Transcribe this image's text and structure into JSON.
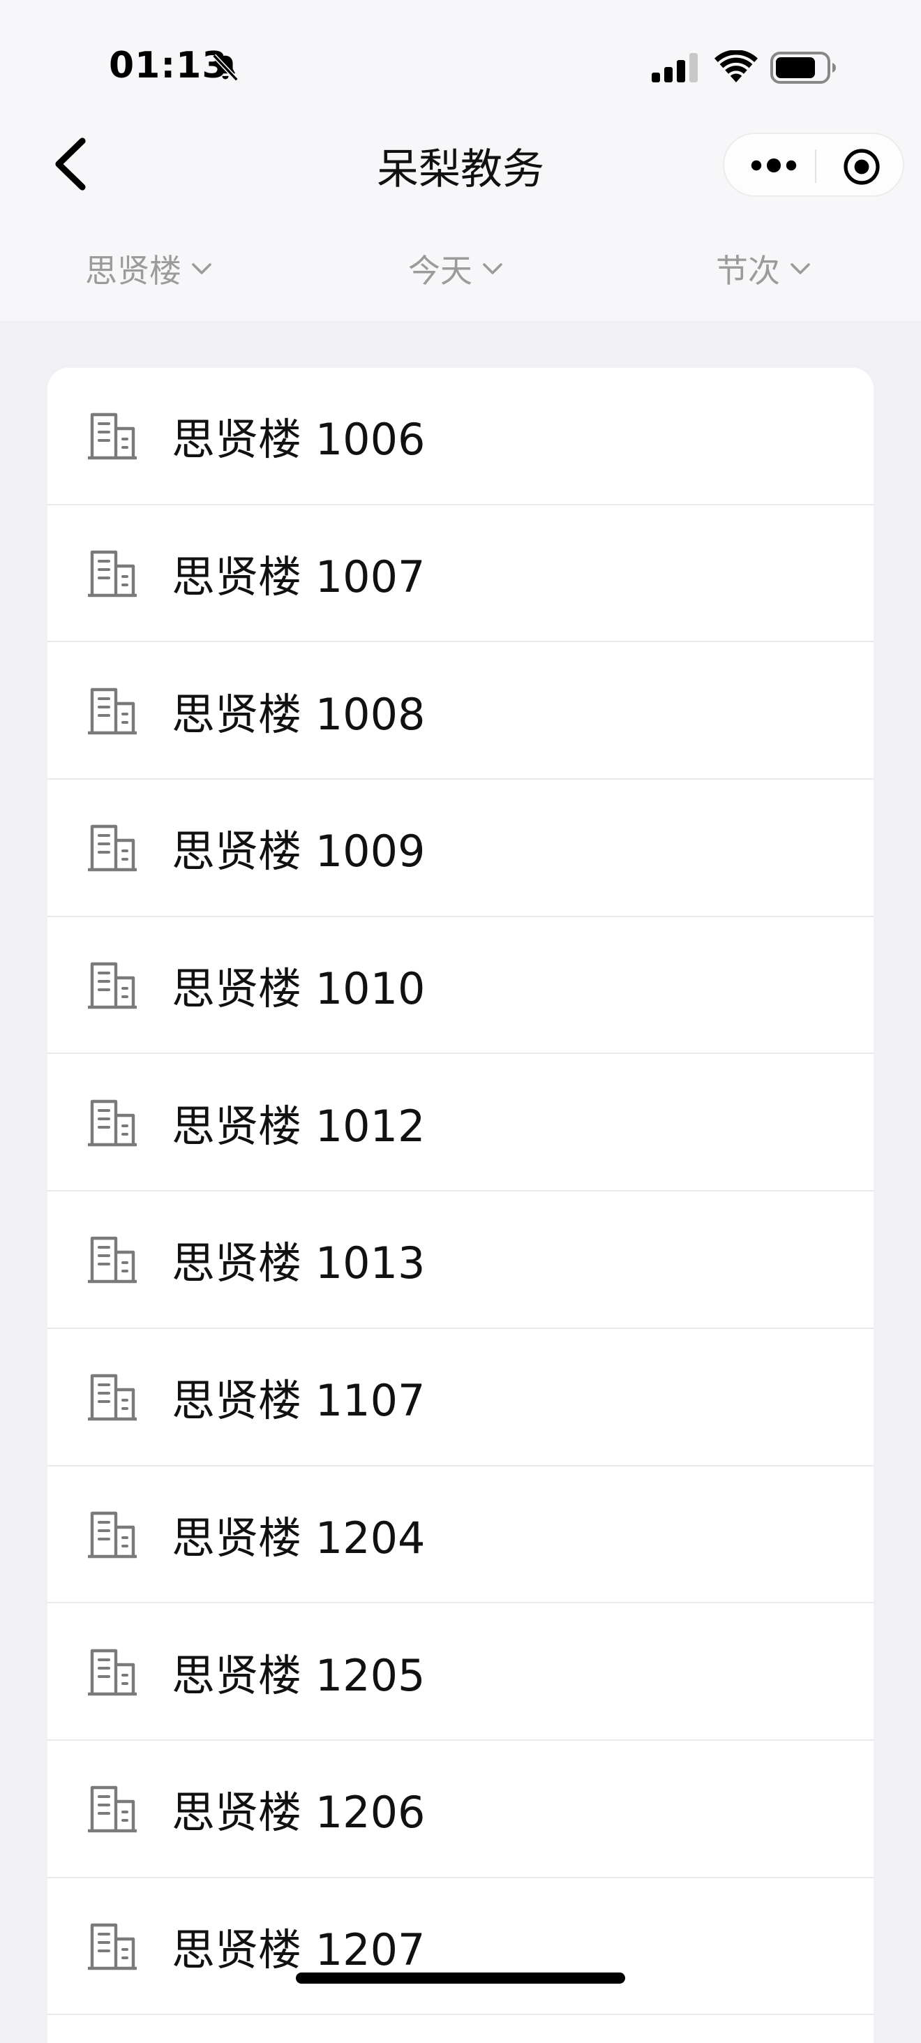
{
  "status_bar": {
    "time": "01:13",
    "icons": [
      "bell-slash-icon",
      "cellular-signal-icon",
      "wifi-icon",
      "battery-icon"
    ]
  },
  "nav": {
    "title": "呆梨教务",
    "icons": [
      "back-chevron-icon",
      "more-dots-icon",
      "target-icon"
    ]
  },
  "filters": [
    {
      "label": "思贤楼",
      "icon": "chevron-down-icon"
    },
    {
      "label": "今天",
      "icon": "chevron-down-icon"
    },
    {
      "label": "节次",
      "icon": "chevron-down-icon"
    }
  ],
  "rooms": [
    {
      "label": "思贤楼 1006",
      "icon": "building-icon"
    },
    {
      "label": "思贤楼 1007",
      "icon": "building-icon"
    },
    {
      "label": "思贤楼 1008",
      "icon": "building-icon"
    },
    {
      "label": "思贤楼 1009",
      "icon": "building-icon"
    },
    {
      "label": "思贤楼 1010",
      "icon": "building-icon"
    },
    {
      "label": "思贤楼 1012",
      "icon": "building-icon"
    },
    {
      "label": "思贤楼 1013",
      "icon": "building-icon"
    },
    {
      "label": "思贤楼 1107",
      "icon": "building-icon"
    },
    {
      "label": "思贤楼 1204",
      "icon": "building-icon"
    },
    {
      "label": "思贤楼 1205",
      "icon": "building-icon"
    },
    {
      "label": "思贤楼 1206",
      "icon": "building-icon"
    },
    {
      "label": "思贤楼 1207",
      "icon": "building-icon"
    }
  ]
}
